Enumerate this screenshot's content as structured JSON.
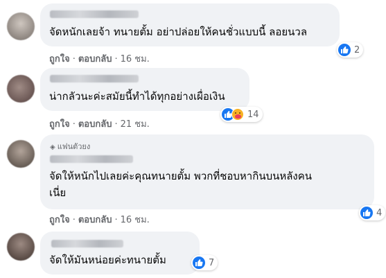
{
  "comments": [
    {
      "text": "จัดหนักเลยจ้า ทนายตั้ม อย่าปล่อยให้คนชั่วแบบนี้ ลอยนวล",
      "reaction_count": "2",
      "like": "ถูกใจ",
      "reply": "ตอบกลับ",
      "time": "16 ชม."
    },
    {
      "text": "น่ากลัวนะค่ะสมัยนี้ทำได้ทุกอย่างเผื่อเงิน",
      "reaction_count": "14",
      "like": "ถูกใจ",
      "reply": "ตอบกลับ",
      "time": "21 ชม."
    },
    {
      "badge": "แฟนตัวยง",
      "text_line1": "จัดให้หนักไปเลยค่ะคุณทนายตั้ม พวกที่ชอบหากินบนหลังคน",
      "text_line2": "เนี่ย",
      "reaction_count": "4",
      "like": "ถูกใจ",
      "reply": "ตอบกลับ",
      "time": "16 ชม."
    },
    {
      "text": "จัดให้มันหน่อยค่ะทนายตั้ม",
      "reaction_count": "7"
    }
  ],
  "separator": "·",
  "icons": {
    "like": "thumbs-up-icon",
    "care": "care-emoji-icon",
    "badge": "diamond-icon"
  },
  "colors": {
    "like_blue": "#1877f2",
    "bubble": "#f0f2f5",
    "meta_gray": "#65676b"
  }
}
